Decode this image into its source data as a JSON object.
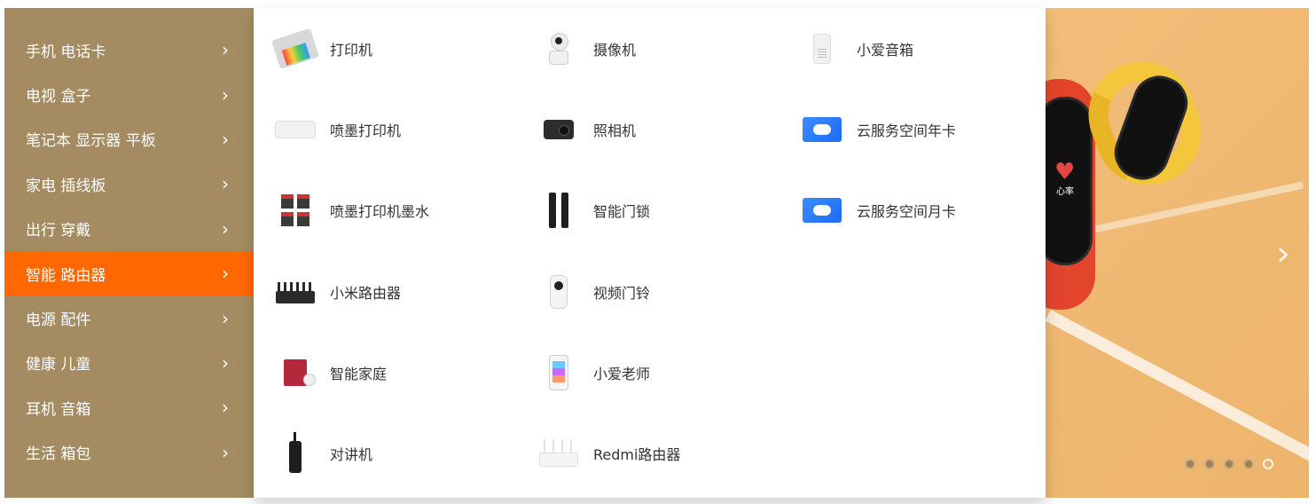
{
  "menu": {
    "items": [
      {
        "label": "手机 电话卡",
        "active": false
      },
      {
        "label": "电视 盒子",
        "active": false
      },
      {
        "label": "笔记本 显示器 平板",
        "active": false
      },
      {
        "label": "家电 插线板",
        "active": false
      },
      {
        "label": "出行 穿戴",
        "active": false
      },
      {
        "label": "智能 路由器",
        "active": true
      },
      {
        "label": "电源 配件",
        "active": false
      },
      {
        "label": "健康 儿童",
        "active": false
      },
      {
        "label": "耳机 音箱",
        "active": false
      },
      {
        "label": "生活 箱包",
        "active": false
      }
    ],
    "chevron": "›"
  },
  "flyout": {
    "columns": [
      [
        {
          "name": "打印机",
          "icon": "printer-icon"
        },
        {
          "name": "喷墨打印机",
          "icon": "inkjet-printer-icon"
        },
        {
          "name": "喷墨打印机墨水",
          "icon": "ink-cartridge-icon"
        },
        {
          "name": "小米路由器",
          "icon": "router-icon"
        },
        {
          "name": "智能家庭",
          "icon": "smart-home-icon"
        },
        {
          "name": "对讲机",
          "icon": "walkie-talkie-icon"
        }
      ],
      [
        {
          "name": "摄像机",
          "icon": "camera-icon"
        },
        {
          "name": "照相机",
          "icon": "photo-camera-icon"
        },
        {
          "name": "智能门锁",
          "icon": "door-lock-icon"
        },
        {
          "name": "视频门铃",
          "icon": "doorbell-icon"
        },
        {
          "name": "小爱老师",
          "icon": "learning-tablet-icon"
        },
        {
          "name": "Redmi路由器",
          "icon": "redmi-router-icon"
        }
      ],
      [
        {
          "name": "小爱音箱",
          "icon": "smart-speaker-icon"
        },
        {
          "name": "云服务空间年卡",
          "icon": "cloud-card-icon"
        },
        {
          "name": "云服务空间月卡",
          "icon": "cloud-card-icon"
        }
      ]
    ]
  },
  "banner": {
    "heart_label": "心率",
    "next_arrow": "›",
    "dots_count": 5,
    "active_dot": 5
  },
  "colors": {
    "active_menu": "#ff6700",
    "menu_bg": "#a48b61",
    "banner_bg": "#f2c07c"
  }
}
